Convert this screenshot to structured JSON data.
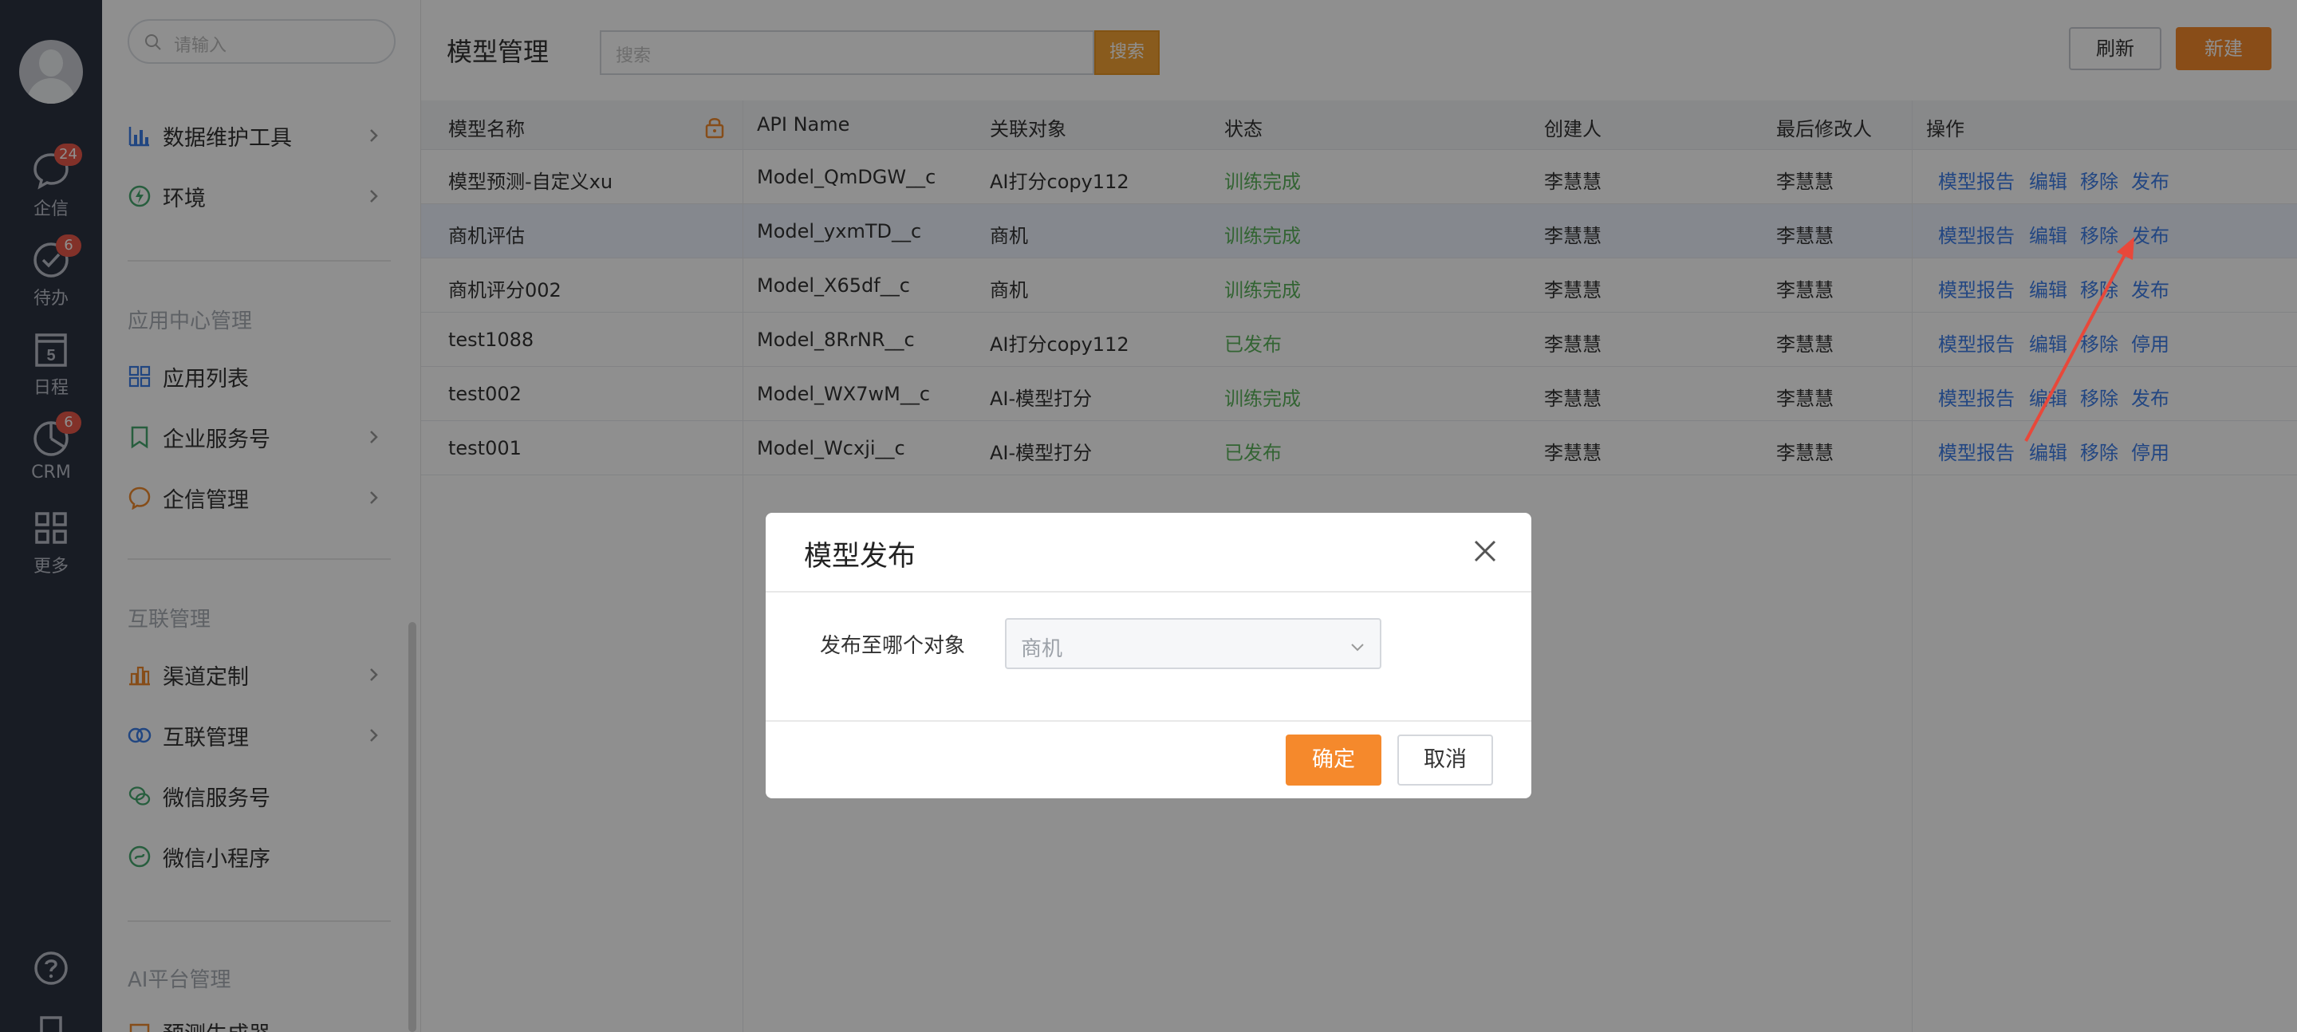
{
  "rail": {
    "items": [
      {
        "label": "企信",
        "badge": "24"
      },
      {
        "label": "待办",
        "badge": "6"
      },
      {
        "label": "日程",
        "badge": "",
        "day": "5"
      },
      {
        "label": "CRM",
        "badge": "6"
      },
      {
        "label": "更多",
        "badge": ""
      }
    ]
  },
  "sidebar": {
    "search_placeholder": "请输入",
    "items": [
      {
        "label": "数据维护工具"
      },
      {
        "label": "环境"
      },
      {
        "label": "应用列表"
      },
      {
        "label": "企业服务号"
      },
      {
        "label": "企信管理"
      },
      {
        "label": "渠道定制"
      },
      {
        "label": "互联管理"
      },
      {
        "label": "微信服务号"
      },
      {
        "label": "微信小程序"
      },
      {
        "label": "预测生成器"
      }
    ],
    "sections": [
      "应用中心管理",
      "互联管理",
      "AI平台管理"
    ]
  },
  "main": {
    "title": "模型管理",
    "search_placeholder": "搜索",
    "search_button": "搜索",
    "refresh_button": "刷新",
    "new_button": "新建",
    "columns": [
      "模型名称",
      "API Name",
      "关联对象",
      "状态",
      "创建人",
      "最后修改人",
      "操作"
    ],
    "rows": [
      {
        "name": "模型预测-自定义xu",
        "api": "Model_QmDGW__c",
        "obj": "AI打分copy112",
        "status": "训练完成",
        "creator": "李慧慧",
        "modifier": "李慧慧",
        "actions": [
          "模型报告",
          "编辑",
          "移除",
          "发布"
        ]
      },
      {
        "name": "商机评估",
        "api": "Model_yxmTD__c",
        "obj": "商机",
        "status": "训练完成",
        "creator": "李慧慧",
        "modifier": "李慧慧",
        "actions": [
          "模型报告",
          "编辑",
          "移除",
          "发布"
        ]
      },
      {
        "name": "商机评分002",
        "api": "Model_X65df__c",
        "obj": "商机",
        "status": "训练完成",
        "creator": "李慧慧",
        "modifier": "李慧慧",
        "actions": [
          "模型报告",
          "编辑",
          "移除",
          "发布"
        ]
      },
      {
        "name": "test1088",
        "api": "Model_8RrNR__c",
        "obj": "AI打分copy112",
        "status": "已发布",
        "creator": "李慧慧",
        "modifier": "李慧慧",
        "actions": [
          "模型报告",
          "编辑",
          "移除",
          "停用"
        ]
      },
      {
        "name": "test002",
        "api": "Model_WX7wM__c",
        "obj": "AI-模型打分",
        "status": "训练完成",
        "creator": "李慧慧",
        "modifier": "李慧慧",
        "actions": [
          "模型报告",
          "编辑",
          "移除",
          "发布"
        ]
      },
      {
        "name": "test001",
        "api": "Model_Wcxji__c",
        "obj": "AI-模型打分",
        "status": "已发布",
        "creator": "李慧慧",
        "modifier": "李慧慧",
        "actions": [
          "模型报告",
          "编辑",
          "移除",
          "停用"
        ]
      }
    ]
  },
  "dialog": {
    "title": "模型发布",
    "field_label": "发布至哪个对象",
    "selected_value": "商机",
    "confirm_button": "确定",
    "cancel_button": "取消"
  },
  "colors": {
    "accent": "#f5892c",
    "link": "#3e7ee8",
    "status_green": "#5bb35b",
    "rail_bg": "#2b3240",
    "annotation_arrow": "#e8483a"
  }
}
